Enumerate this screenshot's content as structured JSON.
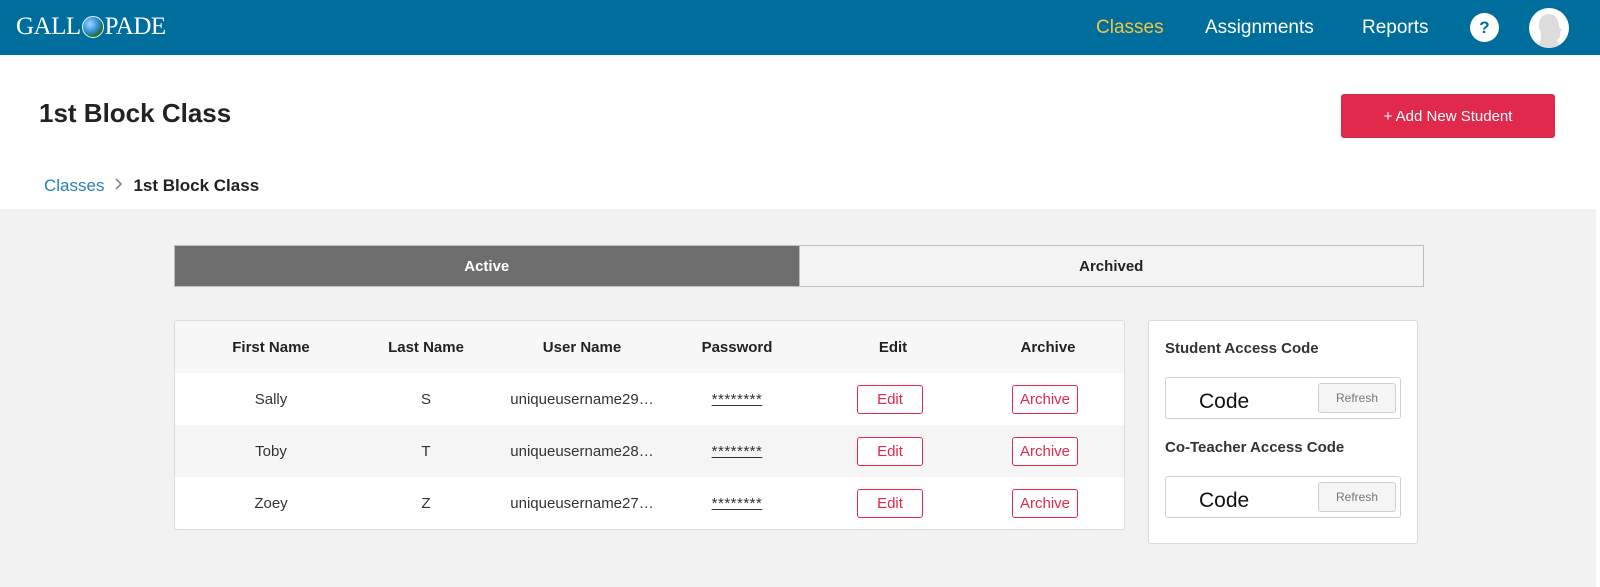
{
  "header": {
    "logo_text": {
      "before": "GALL",
      "after": "PADE"
    },
    "nav": [
      "Classes",
      "Assignments",
      "Reports"
    ],
    "active_nav": "Classes",
    "help_label": "?",
    "colors": {
      "bar": "#006e9d",
      "active_nav": "#f3c344",
      "accent": "#e0294b"
    }
  },
  "page": {
    "title": "1st Block Class",
    "add_button": "+ Add New Student",
    "breadcrumb": {
      "parent": "Classes",
      "current": "1st Block Class"
    }
  },
  "tabs": {
    "active": "Active",
    "archived": "Archived"
  },
  "table": {
    "columns": [
      "First Name",
      "Last Name",
      "User Name",
      "Password",
      "Edit",
      "Archive"
    ],
    "rows": [
      {
        "first": "Sally",
        "last": "S",
        "username": "uniqueusername29…",
        "password": "********",
        "edit": "Edit",
        "archive": "Archive"
      },
      {
        "first": "Toby",
        "last": "T",
        "username": "uniqueusername28…",
        "password": "********",
        "edit": "Edit",
        "archive": "Archive"
      },
      {
        "first": "Zoey",
        "last": "Z",
        "username": "uniqueusername27…",
        "password": "********",
        "edit": "Edit",
        "archive": "Archive"
      }
    ]
  },
  "access_codes": {
    "student": {
      "label": "Student Access Code",
      "value": "Code",
      "refresh": "Refresh"
    },
    "coteacher": {
      "label": "Co-Teacher Access Code",
      "value": "Code",
      "refresh": "Refresh"
    }
  },
  "icons": {
    "help": "help-icon",
    "avatar": "user-avatar-icon",
    "breadcrumb_sep": "chevron-right-icon",
    "logo": "globe-icon"
  }
}
